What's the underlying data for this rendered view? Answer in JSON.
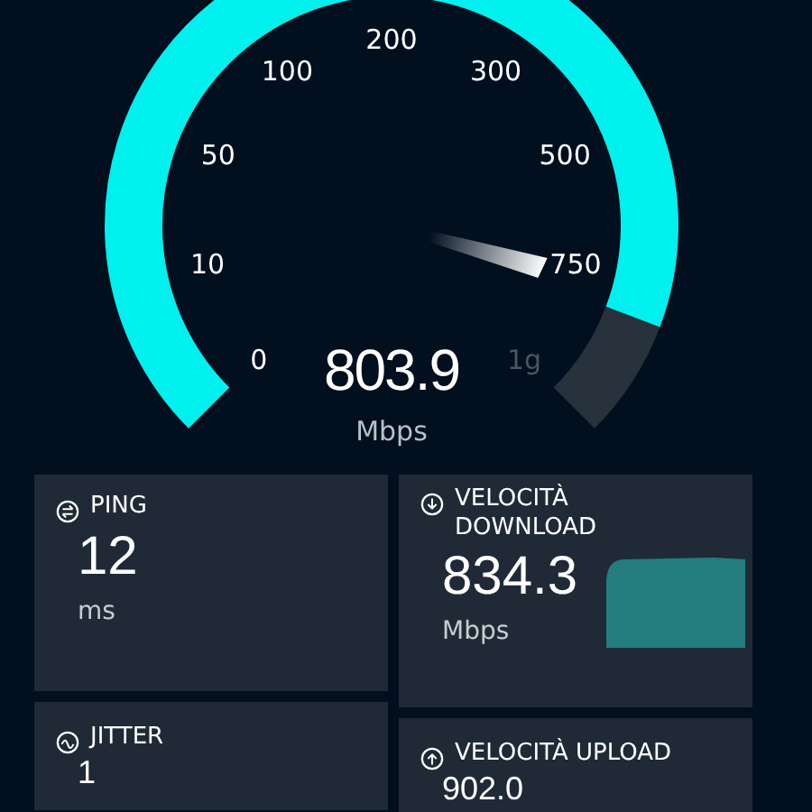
{
  "gauge": {
    "ticks": [
      {
        "label": "0",
        "reached": true
      },
      {
        "label": "10",
        "reached": true
      },
      {
        "label": "50",
        "reached": true
      },
      {
        "label": "100",
        "reached": true
      },
      {
        "label": "200",
        "reached": true
      },
      {
        "label": "300",
        "reached": true
      },
      {
        "label": "500",
        "reached": true
      },
      {
        "label": "750",
        "reached": true
      },
      {
        "label": "1g",
        "reached": false
      }
    ],
    "reading": "803.9",
    "unit": "Mbps"
  },
  "cards": [
    {
      "kind": "ping",
      "label": "PING",
      "value": "12",
      "unit": "ms"
    },
    {
      "kind": "download",
      "label": "VELOCITÀ DOWNLOAD",
      "value": "834.3",
      "unit": "Mbps"
    },
    {
      "kind": "jitter",
      "label": "JITTER",
      "value": "1"
    },
    {
      "kind": "upload",
      "label": "VELOCITÀ UPLOAD",
      "value": "902.0"
    }
  ]
}
